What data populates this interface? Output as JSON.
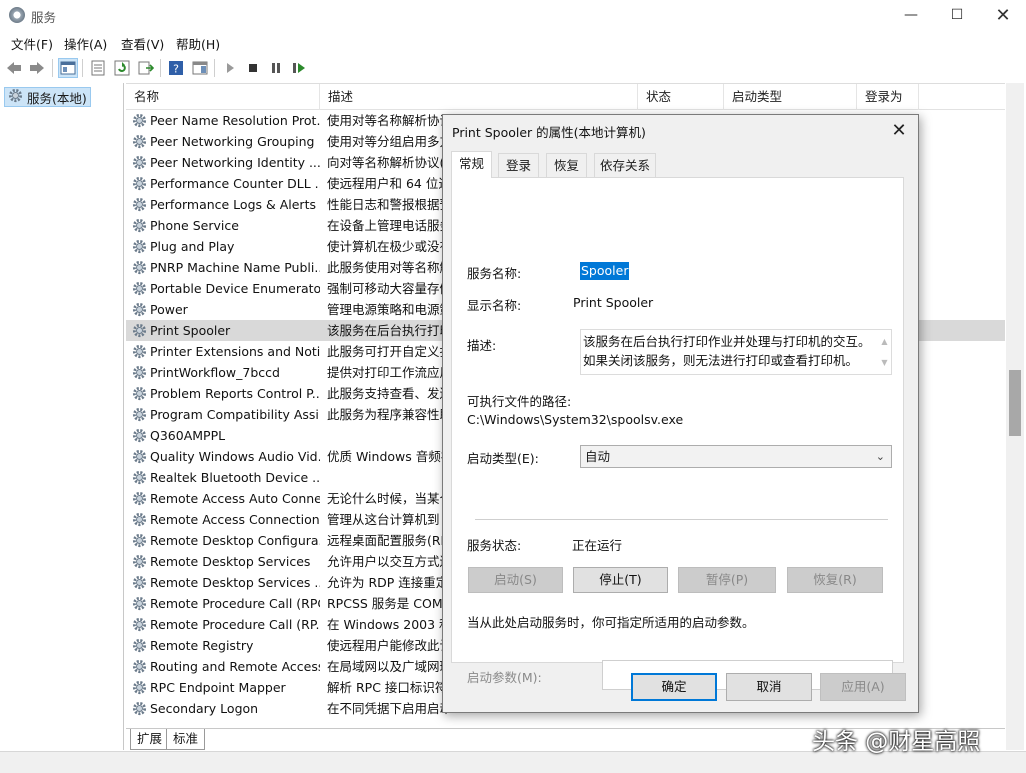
{
  "window": {
    "title": "服务"
  },
  "menu": [
    "文件(F)",
    "操作(A)",
    "查看(V)",
    "帮助(H)"
  ],
  "tree": {
    "root": "服务(本地)"
  },
  "columns": [
    "名称",
    "描述",
    "状态",
    "启动类型",
    "登录为"
  ],
  "services": [
    {
      "name": "Peer Name Resolution Prot...",
      "desc": "使用对等名称解析协议"
    },
    {
      "name": "Peer Networking Grouping",
      "desc": "使用对等分组启用多方"
    },
    {
      "name": "Peer Networking Identity ...",
      "desc": "向对等名称解析协议(P"
    },
    {
      "name": "Performance Counter DLL ...",
      "desc": "使远程用户和 64 位进"
    },
    {
      "name": "Performance Logs & Alerts",
      "desc": "性能日志和警报根据预"
    },
    {
      "name": "Phone Service",
      "desc": "在设备上管理电话服务"
    },
    {
      "name": "Plug and Play",
      "desc": "使计算机在极少或没有"
    },
    {
      "name": "PNRP Machine Name Publi...",
      "desc": "此服务使用对等名称解"
    },
    {
      "name": "Portable Device Enumerato...",
      "desc": "强制可移动大容量存储"
    },
    {
      "name": "Power",
      "desc": "管理电源策略和电源策"
    },
    {
      "name": "Print Spooler",
      "desc": "该服务在后台执行打印"
    },
    {
      "name": "Printer Extensions and Noti...",
      "desc": "此服务可打开自定义打"
    },
    {
      "name": "PrintWorkflow_7bccd",
      "desc": "提供对打印工作流应用"
    },
    {
      "name": "Problem Reports Control P...",
      "desc": "此服务支持查看、发送"
    },
    {
      "name": "Program Compatibility Assi...",
      "desc": "此服务为程序兼容性助"
    },
    {
      "name": "Q360AMPPL",
      "desc": ""
    },
    {
      "name": "Quality Windows Audio Vid...",
      "desc": "优质 Windows 音频视"
    },
    {
      "name": "Realtek Bluetooth Device ...",
      "desc": ""
    },
    {
      "name": "Remote Access Auto Conne...",
      "desc": "无论什么时候，当某个"
    },
    {
      "name": "Remote Access Connection...",
      "desc": "管理从这台计算机到 I"
    },
    {
      "name": "Remote Desktop Configura...",
      "desc": "远程桌面配置服务(RD"
    },
    {
      "name": "Remote Desktop Services",
      "desc": "允许用户以交互方式连"
    },
    {
      "name": "Remote Desktop Services ...",
      "desc": "允许为 RDP 连接重定"
    },
    {
      "name": "Remote Procedure Call (RPC)",
      "desc": "RPCSS 服务是 COM"
    },
    {
      "name": "Remote Procedure Call (RP...",
      "desc": "在 Windows 2003 和"
    },
    {
      "name": "Remote Registry",
      "desc": "使远程用户能修改此计"
    },
    {
      "name": "Routing and Remote Access",
      "desc": "在局域网以及广域网环"
    },
    {
      "name": "RPC Endpoint Mapper",
      "desc": "解析 RPC 接口标识符"
    },
    {
      "name": "Secondary Logon",
      "desc": "在不同凭据下启用启动"
    }
  ],
  "selected_service": "Print Spooler",
  "bottom_tabs": [
    "扩展",
    "标准"
  ],
  "dialog": {
    "title": "Print Spooler 的属性(本地计算机)",
    "tabs": [
      "常规",
      "登录",
      "恢复",
      "依存关系"
    ],
    "service_name_label": "服务名称:",
    "service_name": "Spooler",
    "display_name_label": "显示名称:",
    "display_name": "Print Spooler",
    "description_label": "描述:",
    "description": "该服务在后台执行打印作业并处理与打印机的交互。如果关闭该服务，则无法进行打印或查看打印机。",
    "path_label": "可执行文件的路径:",
    "path": "C:\\Windows\\System32\\spoolsv.exe",
    "startup_type_label": "启动类型(E):",
    "startup_type": "自动",
    "status_label": "服务状态:",
    "status": "正在运行",
    "buttons": {
      "start": "启动(S)",
      "stop": "停止(T)",
      "pause": "暂停(P)",
      "resume": "恢复(R)"
    },
    "hint": "当从此处启动服务时，你可指定所适用的启动参数。",
    "params_label": "启动参数(M):",
    "ok": "确定",
    "cancel": "取消",
    "apply": "应用(A)"
  },
  "watermark": "头条 @财星高照"
}
